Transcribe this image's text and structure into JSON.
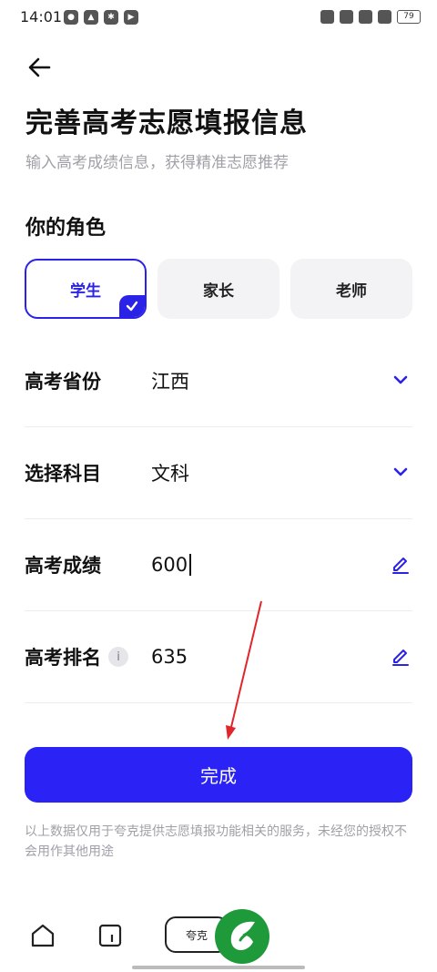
{
  "status_bar": {
    "time": "14:01",
    "battery": "79"
  },
  "page": {
    "title": "完善高考志愿填报信息",
    "subtitle": "输入高考成绩信息，获得精准志愿推荐",
    "role_label": "你的角色"
  },
  "roles": [
    {
      "label": "学生",
      "selected": true
    },
    {
      "label": "家长",
      "selected": false
    },
    {
      "label": "老师",
      "selected": false
    }
  ],
  "form": {
    "province": {
      "label": "高考省份",
      "value": "江西"
    },
    "subject": {
      "label": "选择科目",
      "value": "文科"
    },
    "score": {
      "label": "高考成绩",
      "value": "600"
    },
    "rank": {
      "label": "高考排名",
      "value": "635",
      "info": "i"
    }
  },
  "done_button": "完成",
  "disclaimer": "以上数据仅用于夸克提供志愿填报功能相关的服务，未经您的授权不会用作其他用途",
  "bottom_nav": {
    "pill_label": "夸克"
  },
  "colors": {
    "accent": "#2b22f5",
    "annotation": "#e0262b",
    "logo_green": "#1e9a3a"
  }
}
